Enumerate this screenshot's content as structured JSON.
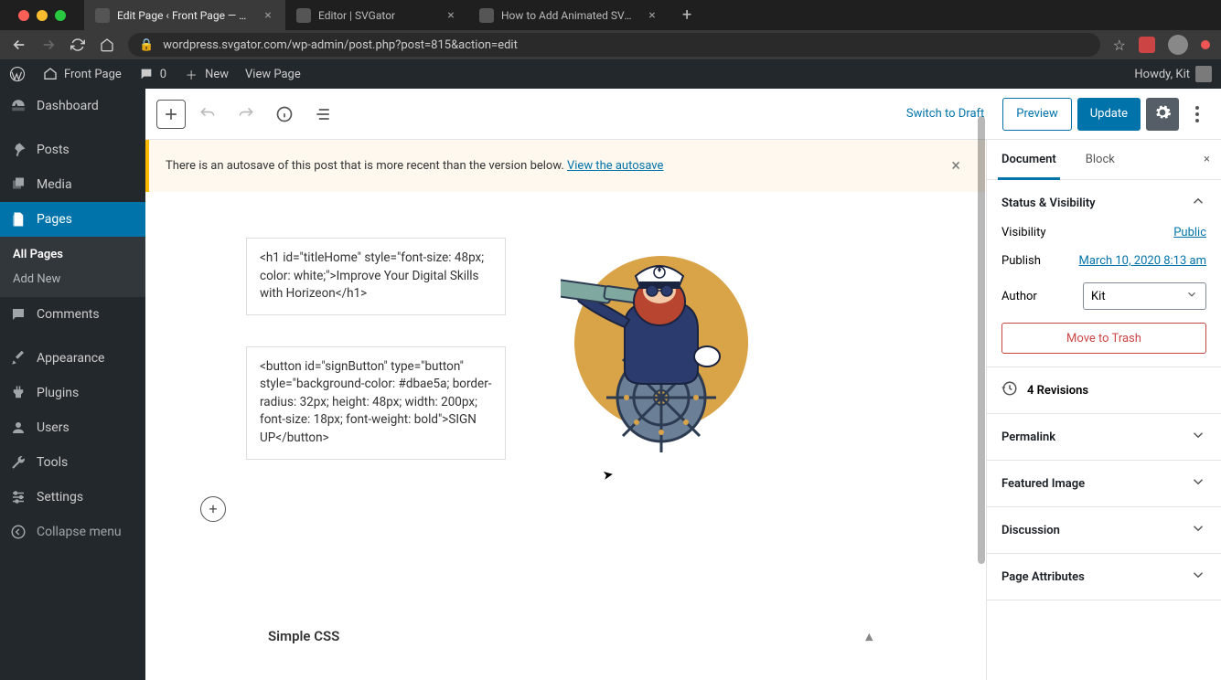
{
  "browser": {
    "tabs": [
      {
        "title": "Edit Page ‹ Front Page — WordP"
      },
      {
        "title": "Editor | SVGator"
      },
      {
        "title": "How to Add Animated SVG to W"
      }
    ],
    "url": "wordpress.svgator.com/wp-admin/post.php?post=815&action=edit"
  },
  "adminbar": {
    "site_name": "Front Page",
    "comments": "0",
    "new_label": "New",
    "view_page": "View Page",
    "howdy": "Howdy, Kit"
  },
  "sidebar": {
    "items": [
      {
        "icon": "dashboard",
        "label": "Dashboard"
      },
      {
        "icon": "posts",
        "label": "Posts"
      },
      {
        "icon": "media",
        "label": "Media"
      },
      {
        "icon": "pages",
        "label": "Pages",
        "active": true
      },
      {
        "icon": "comments",
        "label": "Comments"
      },
      {
        "icon": "appearance",
        "label": "Appearance"
      },
      {
        "icon": "plugins",
        "label": "Plugins"
      },
      {
        "icon": "users",
        "label": "Users"
      },
      {
        "icon": "tools",
        "label": "Tools"
      },
      {
        "icon": "settings",
        "label": "Settings"
      },
      {
        "icon": "collapse",
        "label": "Collapse menu"
      }
    ],
    "submenu": [
      {
        "label": "All Pages",
        "active": true
      },
      {
        "label": "Add New"
      }
    ]
  },
  "toolbar": {
    "switch_draft": "Switch to Draft",
    "preview": "Preview",
    "update": "Update"
  },
  "notice": {
    "text": "There is an autosave of this post that is more recent than the version below. ",
    "link": "View the autosave"
  },
  "content": {
    "code1": "<h1 id=\"titleHome\" style=\"font-size: 48px; color: white;\">Improve Your Digital Skills\nwith Horizeon</h1>",
    "code2": "<button id=\"signButton\" type=\"button\" style=\"background-color: #dbae5a; border-radius: 32px; height: 48px; width: 200px; font-size: 18px; font-weight: bold\">SIGN UP</button>",
    "simple_css": "Simple CSS"
  },
  "inspector": {
    "tabs": {
      "doc": "Document",
      "block": "Block"
    },
    "status_vis": "Status & Visibility",
    "visibility_label": "Visibility",
    "visibility_value": "Public",
    "publish_label": "Publish",
    "publish_value": "March 10, 2020 8:13 am",
    "author_label": "Author",
    "author_value": "Kit",
    "trash": "Move to Trash",
    "revisions": "4 Revisions",
    "permalink": "Permalink",
    "featured_image": "Featured Image",
    "discussion": "Discussion",
    "page_attributes": "Page Attributes"
  }
}
